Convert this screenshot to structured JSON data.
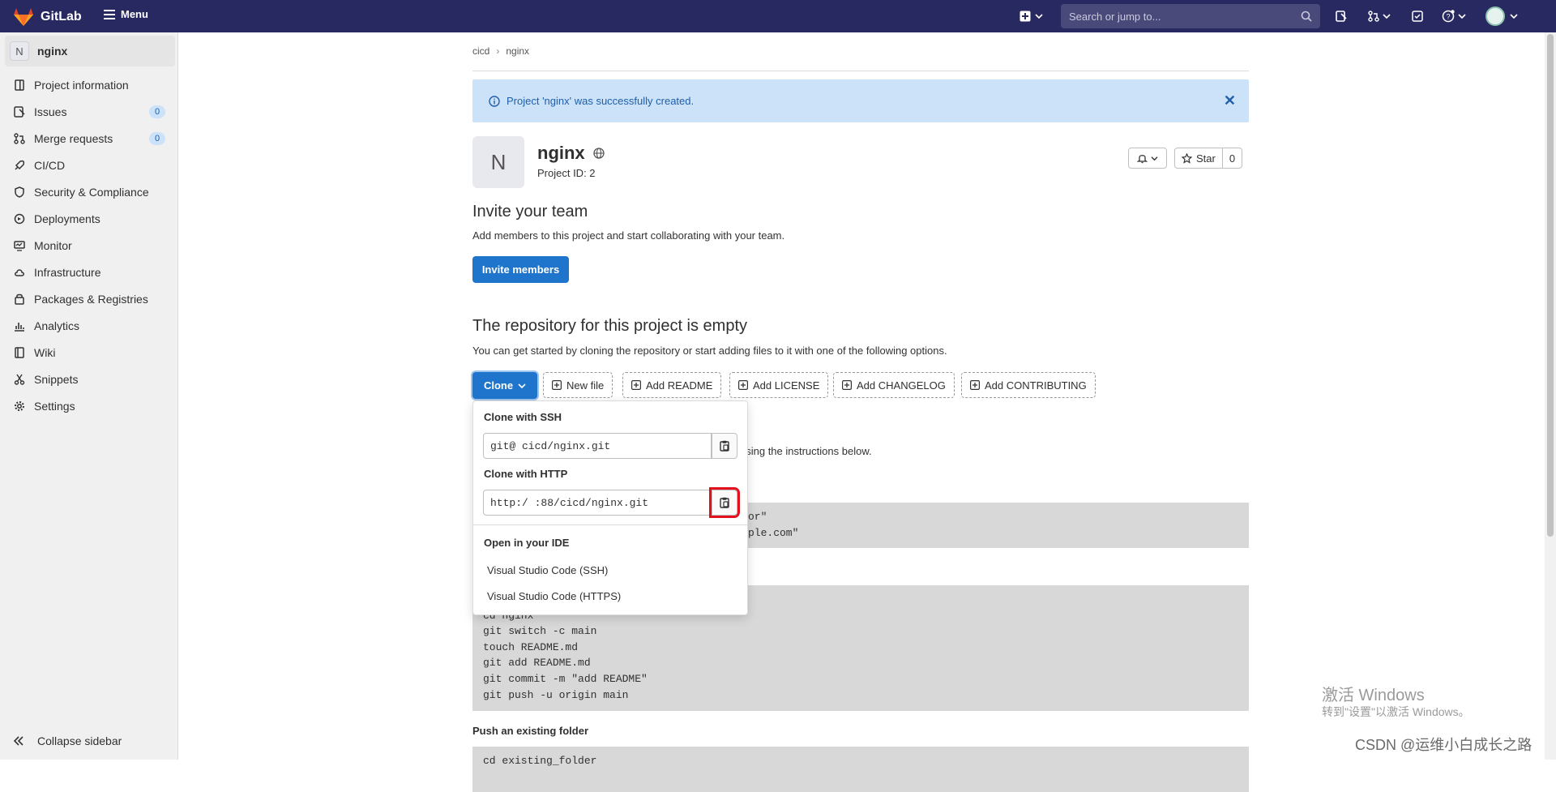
{
  "topbar": {
    "logo_text": "GitLab",
    "menu_label": "Menu",
    "search_placeholder": "Search or jump to..."
  },
  "sidebar": {
    "project_initial": "N",
    "project_name": "nginx",
    "items": [
      {
        "label": "Project information",
        "icon": "project-info-icon"
      },
      {
        "label": "Issues",
        "icon": "issues-icon",
        "badge": "0"
      },
      {
        "label": "Merge requests",
        "icon": "merge-request-icon",
        "badge": "0"
      },
      {
        "label": "CI/CD",
        "icon": "rocket-icon"
      },
      {
        "label": "Security & Compliance",
        "icon": "shield-icon"
      },
      {
        "label": "Deployments",
        "icon": "deployments-icon"
      },
      {
        "label": "Monitor",
        "icon": "monitor-icon"
      },
      {
        "label": "Infrastructure",
        "icon": "cloud-gear-icon"
      },
      {
        "label": "Packages & Registries",
        "icon": "package-icon"
      },
      {
        "label": "Analytics",
        "icon": "chart-icon"
      },
      {
        "label": "Wiki",
        "icon": "book-icon"
      },
      {
        "label": "Snippets",
        "icon": "scissors-icon"
      },
      {
        "label": "Settings",
        "icon": "gear-icon"
      }
    ],
    "collapse_label": "Collapse sidebar"
  },
  "breadcrumb": {
    "parent": "cicd",
    "current": "nginx"
  },
  "alert": {
    "message": "Project 'nginx' was successfully created."
  },
  "project": {
    "initial": "N",
    "name": "nginx",
    "id_text": "Project ID: 2",
    "star_label": "Star",
    "star_count": "0"
  },
  "invite": {
    "heading": "Invite your team",
    "text": "Add members to this project and start collaborating with your team.",
    "button": "Invite members"
  },
  "empty_repo": {
    "heading": "The repository for this project is empty",
    "text": "You can get started by cloning the repository or start adding files to it with one of the following options.",
    "buttons": {
      "clone": "Clone",
      "new_file": "New file",
      "add_readme": "Add README",
      "add_license": "Add LICENSE",
      "add_changelog": "Add CHANGELOG",
      "add_contributing": "Add CONTRIBUTING"
    },
    "instructions_tail": "using the instructions below.",
    "code1_line1": "or\"",
    "code1_line2": "ple.com\"",
    "code2_lines": "inx.git\ncd nginx\ngit switch -c main\ntouch README.md\ngit add README.md\ngit commit -m \"add README\"\ngit push -u origin main",
    "push_existing": "Push an existing folder",
    "code3_line1": "cd existing_folder"
  },
  "clone_dropdown": {
    "ssh_label": "Clone with SSH",
    "ssh_value": "git@              cicd/nginx.git",
    "http_label": "Clone with HTTP",
    "http_value": "http:/                 :88/cicd/nginx.git",
    "ide_label": "Open in your IDE",
    "ide_items": [
      "Visual Studio Code (SSH)",
      "Visual Studio Code (HTTPS)"
    ]
  },
  "watermark": {
    "line1": "激活 Windows",
    "line2": "转到\"设置\"以激活 Windows。",
    "csdn": "CSDN @运维小白成长之路"
  },
  "colors": {
    "topbar": "#292961",
    "primary": "#1f75cb",
    "alert_bg": "#cbe2f9",
    "highlight": "#e5101d"
  }
}
